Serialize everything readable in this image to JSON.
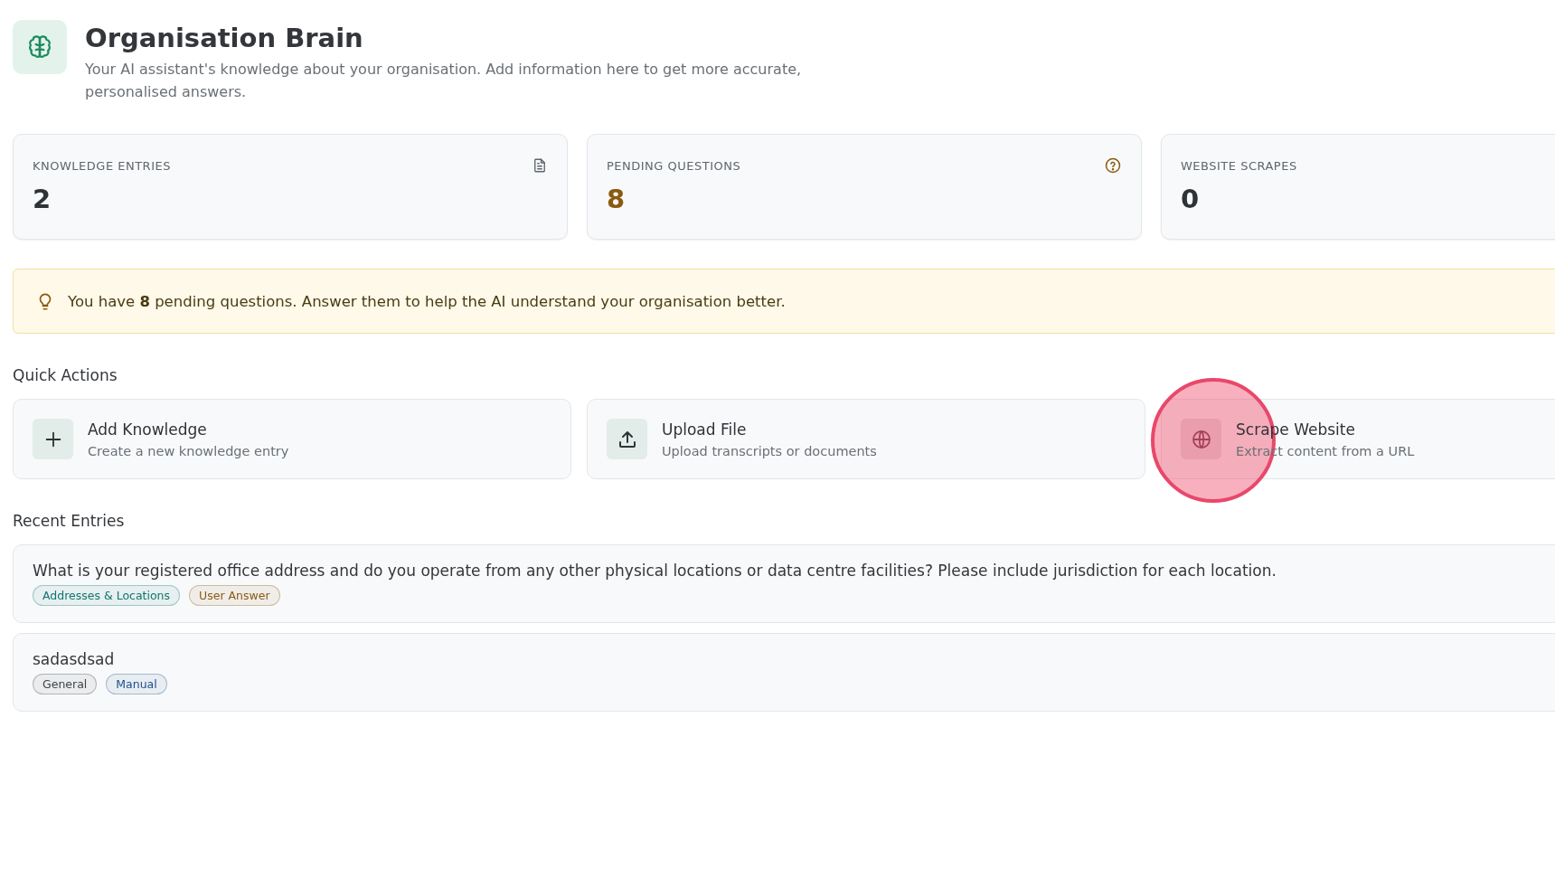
{
  "header": {
    "title": "Organisation Brain",
    "subtitle": "Your AI assistant's knowledge about your organisation. Add information here to get more accurate, personalised answers."
  },
  "stats": [
    {
      "label": "KNOWLEDGE ENTRIES",
      "value": "2",
      "kind": "document",
      "color": "#2f3337"
    },
    {
      "label": "PENDING QUESTIONS",
      "value": "8",
      "kind": "question",
      "color": "#8a5a10"
    },
    {
      "label": "WEBSITE SCRAPES",
      "value": "0",
      "kind": "none",
      "color": "#2f3337"
    }
  ],
  "notice": {
    "text": "You have **8** pending questions. Answer them to help the AI understand your organisation better."
  },
  "quick_actions": {
    "title": "Quick Actions",
    "items": [
      {
        "title": "Add Knowledge",
        "description": "Create a new knowledge entry",
        "kind": "plus",
        "clicked": false
      },
      {
        "title": "Upload File",
        "description": "Upload transcripts or documents",
        "kind": "upload",
        "clicked": false
      },
      {
        "title": "Scrape Website",
        "description": "Extract content from a URL",
        "kind": "globe",
        "clicked": true
      }
    ]
  },
  "recent_entries": {
    "title": "Recent Entries",
    "items": [
      {
        "title": "What is your registered office address and do you operate from any other physical locations or data centre facilities? Please include jurisdiction for each location.",
        "tags": [
          {
            "label": "Addresses & Locations",
            "color": "#0f766e"
          },
          {
            "label": "User Answer",
            "color": "#8a5a10"
          }
        ]
      },
      {
        "title": "sadasdsad",
        "tags": [
          {
            "label": "General",
            "color": "#3f4448"
          },
          {
            "label": "Manual",
            "color": "#1e4e8c"
          }
        ]
      }
    ]
  }
}
